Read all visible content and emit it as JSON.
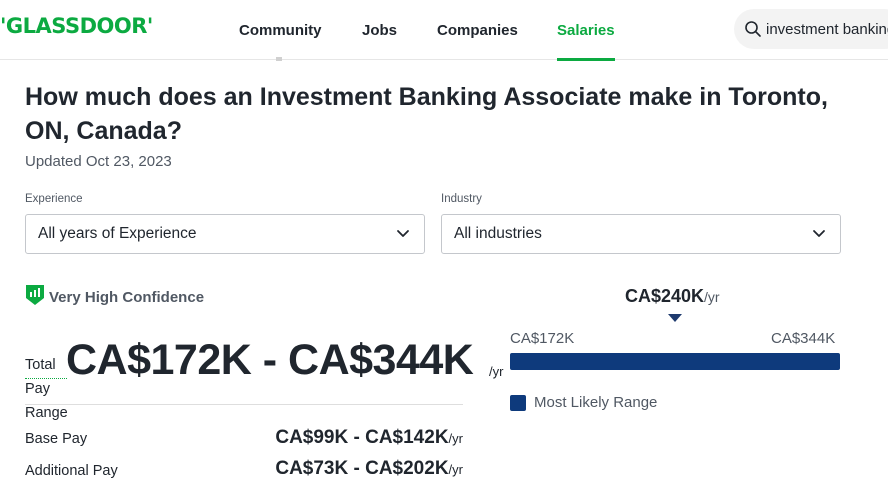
{
  "header": {
    "logo": "'GLASSDOOR'",
    "nav": [
      {
        "label": "Community"
      },
      {
        "label": "Jobs"
      },
      {
        "label": "Companies"
      },
      {
        "label": "Salaries"
      }
    ],
    "active_nav": "Salaries",
    "search_value": "investment banking"
  },
  "page": {
    "title": "How much does an Investment Banking Associate make in Toronto, ON, Canada?",
    "updated": "Updated Oct 23, 2023"
  },
  "filters": {
    "experience": {
      "label": "Experience",
      "value": "All years of Experience"
    },
    "industry": {
      "label": "Industry",
      "value": "All industries"
    }
  },
  "confidence": "Very High Confidence",
  "pay": {
    "total_label_lines": [
      "Total",
      "Pay",
      "Range"
    ],
    "total_range": "CA$172K - CA$344K",
    "unit": "/yr",
    "rows": [
      {
        "label": "Base Pay",
        "value": "CA$99K - CA$142K",
        "unit": "/yr"
      },
      {
        "label": "Additional Pay",
        "value": "CA$73K - CA$202K",
        "unit": "/yr"
      }
    ]
  },
  "range_chart": {
    "median": "CA$240K",
    "median_unit": "/yr",
    "low": "CA$172K",
    "high": "CA$344K",
    "legend": "Most Likely Range",
    "bar_color": "#0e3a7c"
  },
  "colors": {
    "brand": "#0caa41",
    "text": "#20262e",
    "muted": "#505863"
  }
}
